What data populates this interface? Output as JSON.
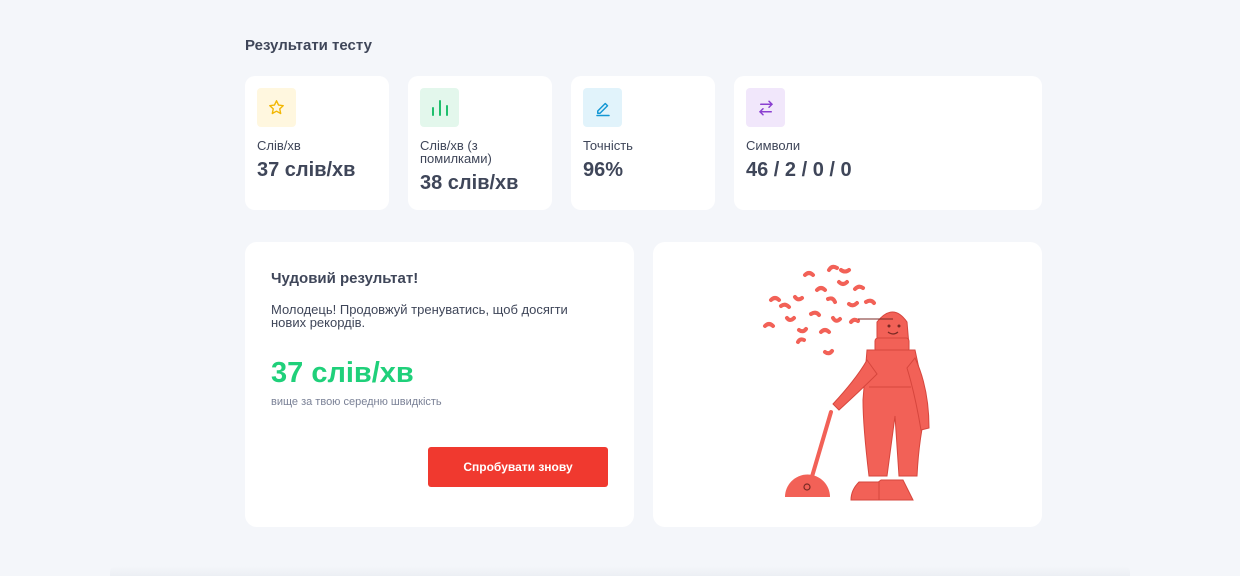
{
  "section": {
    "title": "Результати тесту"
  },
  "stats": [
    {
      "label": "Слів/хв",
      "value": "37 слів/хв",
      "icon": "star-icon",
      "icon_color": "#f2b705",
      "icon_bg": "#fff7df"
    },
    {
      "label": "Слів/хв (з помилками)",
      "value": "38 слів/хв",
      "icon": "bar-chart-icon",
      "icon_color": "#1fbf6d",
      "icon_bg": "#e3f7ec"
    },
    {
      "label": "Точність",
      "value": "96%",
      "icon": "pencil-icon",
      "icon_color": "#1497d4",
      "icon_bg": "#e1f3fb"
    },
    {
      "label": "Символи",
      "value": "46 / 2 / 0 / 0",
      "icon": "swap-arrows-icon",
      "icon_color": "#8a3fd0",
      "icon_bg": "#f1e7fb"
    }
  ],
  "result": {
    "title": "Чудовий результат!",
    "text": "Молодець! Продовжуй тренуватись, щоб досягти нових рекордів.",
    "speed": "37 слів/хв",
    "note": "вище за твою середню швидкість",
    "retry_label": "Спробувати знову"
  },
  "colors": {
    "accent_red": "#f0392f",
    "accent_green": "#1fd07a",
    "figure": "#f26157"
  }
}
